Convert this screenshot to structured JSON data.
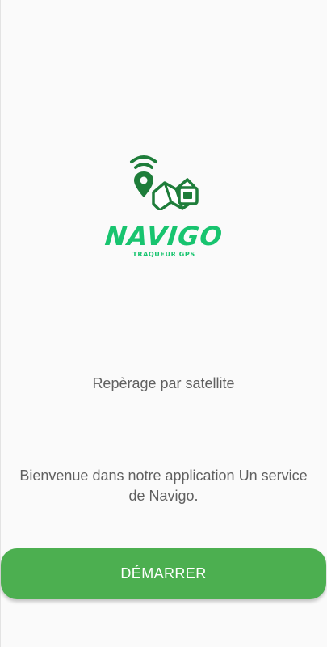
{
  "logo": {
    "name": "NAVIGO",
    "tagline": "TRAQUEUR GPS",
    "icon": "gps-map-logo-icon",
    "colors": {
      "dark": "#1e7d3a",
      "light": "#18c46f"
    }
  },
  "main": {
    "subtitle": "Repèrage par satellite",
    "welcome": "Bienvenue dans notre application Un service de Navigo."
  },
  "button": {
    "label": "DÉMARRER",
    "color": "#4caf50"
  }
}
